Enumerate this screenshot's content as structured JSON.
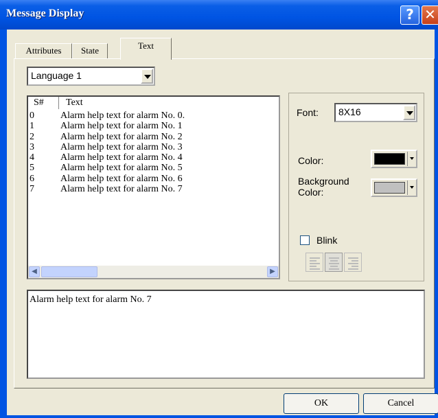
{
  "window": {
    "title": "Message Display"
  },
  "tabs": [
    {
      "label": "Attributes"
    },
    {
      "label": "State"
    },
    {
      "label": "Text"
    }
  ],
  "language": {
    "selected": "Language 1"
  },
  "list": {
    "headers": {
      "sn": "S#",
      "text": "Text"
    },
    "rows": [
      {
        "sn": "0",
        "text": "Alarm help text for alarm No. 0."
      },
      {
        "sn": "1",
        "text": "Alarm help text for alarm No. 1"
      },
      {
        "sn": "2",
        "text": "Alarm help text for alarm No. 2"
      },
      {
        "sn": "3",
        "text": "Alarm help text for alarm No. 3"
      },
      {
        "sn": "4",
        "text": "Alarm help text for alarm No. 4"
      },
      {
        "sn": "5",
        "text": "Alarm help text for alarm No. 5"
      },
      {
        "sn": "6",
        "text": "Alarm help text for alarm No. 6"
      },
      {
        "sn": "7",
        "text": "Alarm help text for alarm No. 7"
      }
    ]
  },
  "props": {
    "font_label": "Font:",
    "font_value": "8X16",
    "color_label": "Color:",
    "color_value": "#000000",
    "bg_label_1": "Background",
    "bg_label_2": "Color:",
    "bg_value": "#c0c0c0",
    "blink_label": "Blink",
    "blink_checked": false
  },
  "edit": {
    "value": "Alarm help text for alarm No. 7"
  },
  "buttons": {
    "ok": "OK",
    "cancel": "Cancel"
  }
}
